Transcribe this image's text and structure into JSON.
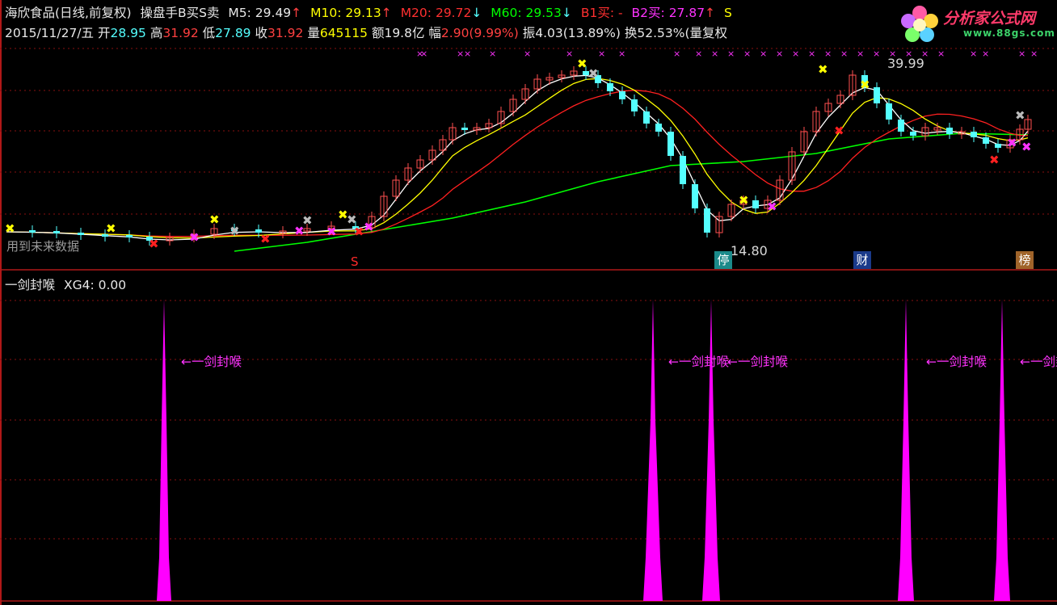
{
  "header": {
    "stock_name": "海欣食品(日线,前复权)",
    "indicator_name": "操盘手B买S卖",
    "m5_label": "M5:",
    "m5_value": "29.49",
    "m5_arrow": "↑",
    "m10_label": "M10:",
    "m10_value": "29.13",
    "m10_arrow": "↑",
    "m20_label": "M20:",
    "m20_value": "29.72",
    "m20_arrow": "↓",
    "m60_label": "M60:",
    "m60_value": "29.53",
    "m60_arrow": "↓",
    "b1_label": "B1买:",
    "b1_value": "-",
    "b2_label": "B2买:",
    "b2_value": "27.87",
    "b2_arrow": "↑",
    "s_label": "S"
  },
  "info": {
    "date": "2015/11/27/五",
    "open_label": "开",
    "open": "28.95",
    "high_label": "高",
    "high": "31.92",
    "low_label": "低",
    "low": "27.89",
    "close_label": "收",
    "close": "31.92",
    "vol_label": "量",
    "vol": "645115",
    "amount_label": "额",
    "amount": "19.8亿",
    "change_label": "幅",
    "change": "2.90(9.99%)",
    "amp_label": "振",
    "amp": "4.03(13.89%)",
    "turnover_label": "换",
    "turnover": "52.53%(量复权",
    "no_data_note": "用到未来数据"
  },
  "main_chart": {
    "high_label": "39.99",
    "low_label": "14.80",
    "markers": {
      "s_signal": "S",
      "stop": "停",
      "finance": "财",
      "rank": "榜"
    },
    "colors": {
      "up": "#ff5050",
      "down": "#54ffff",
      "m5": "#ffffff",
      "m10": "#ffff00",
      "m20": "#ff2020",
      "m60": "#00ff00",
      "signal": "#ff33ff"
    }
  },
  "indicator": {
    "title": "一剑封喉",
    "xg_label": "XG4:",
    "xg_value": "0.00",
    "annotation": "←一剑封喉",
    "color": "#ff00ff"
  },
  "logo": {
    "text_cn": "分析家公式网",
    "url": "www.88gs.com"
  }
}
